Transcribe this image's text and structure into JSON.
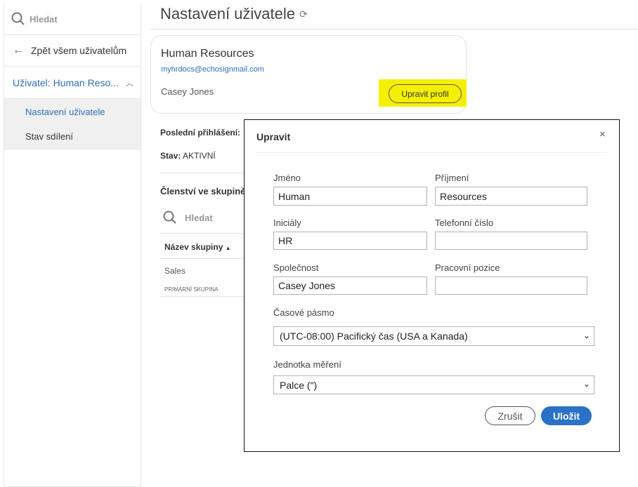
{
  "sidebar": {
    "search_placeholder": "Hledat",
    "back": "Zpět všem uživatelům",
    "user": "Uživatel: Human Reso...",
    "items": [
      {
        "label": "Nastavení uživatele",
        "active": true
      },
      {
        "label": "Stav sdílení",
        "active": false
      }
    ]
  },
  "header": {
    "title": "Nastavení uživatele"
  },
  "card": {
    "name": "Human Resources",
    "email": "myhrdocs@echosignmail.com",
    "company": "Casey Jones",
    "edit_button": "Upravit profil",
    "highlight_color": "#f5f000"
  },
  "details": {
    "last_login_label": "Poslední přihlášení:",
    "status_label": "Stav:",
    "status_value": "AKTIVNÍ",
    "group_heading": "Členství ve skupině",
    "search_placeholder": "Hledat",
    "column_header": "Název skupiny",
    "groups": [
      {
        "name": "Sales",
        "tag": "PRIMÁRNÍ SKUPINA"
      }
    ]
  },
  "modal": {
    "title": "Upravit",
    "fields": {
      "first_name": {
        "label": "Jméno",
        "value": "Human"
      },
      "last_name": {
        "label": "Příjmení",
        "value": "Resources"
      },
      "initials": {
        "label": "Iniciály",
        "value": "HR"
      },
      "phone": {
        "label": "Telefonní číslo",
        "value": ""
      },
      "company": {
        "label": "Společnost",
        "value": "Casey Jones"
      },
      "title": {
        "label": "Pracovní pozice",
        "value": ""
      },
      "timezone": {
        "label": "Časové pásmo",
        "value": "(UTC-08:00) Pacifický čas (USA a Kanada)"
      },
      "unit": {
        "label": "Jednotka měření",
        "value": "Palce (\")"
      }
    },
    "cancel": "Zrušit",
    "save": "Uložit",
    "accent": "#2a72c6"
  }
}
